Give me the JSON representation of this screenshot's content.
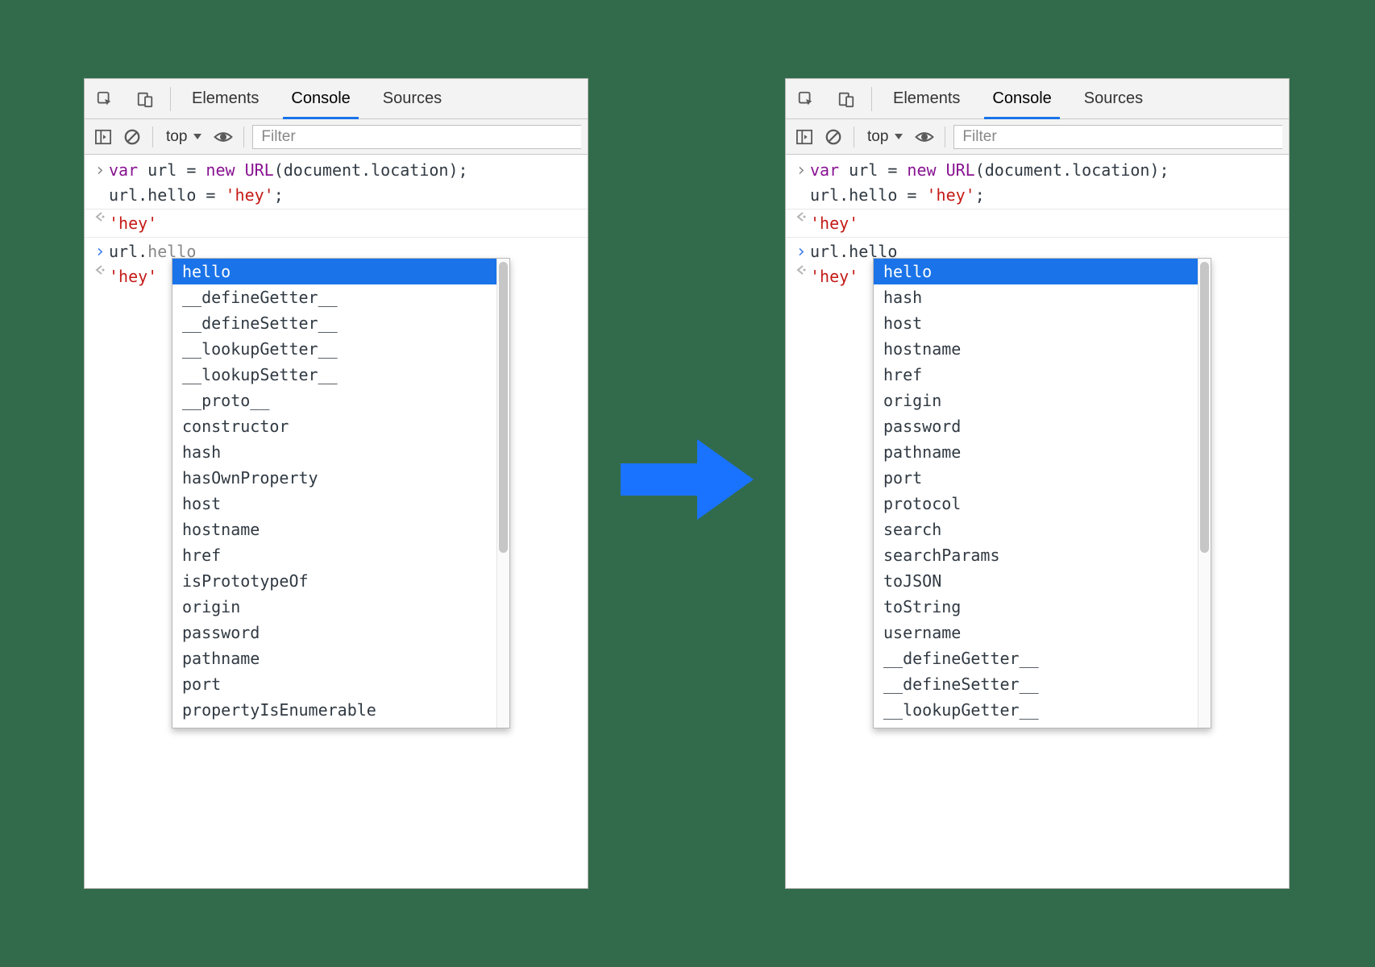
{
  "tabs": {
    "elements": "Elements",
    "console": "Console",
    "sources": "Sources"
  },
  "toolbar": {
    "context": "top",
    "filter_placeholder": "Filter"
  },
  "console": {
    "line1a": "var",
    "line1b": " url = ",
    "line1c": "new",
    "line1d": " URL",
    "line1e": "(document.location);",
    "line2": "url.hello = ",
    "line2s": "'hey'",
    "line2t": ";",
    "out1": "'hey'",
    "in2a": "url.",
    "in2b": "hello",
    "out2": "'hey'"
  },
  "autocomplete_left": [
    "hello",
    "__defineGetter__",
    "__defineSetter__",
    "__lookupGetter__",
    "__lookupSetter__",
    "__proto__",
    "constructor",
    "hash",
    "hasOwnProperty",
    "host",
    "hostname",
    "href",
    "isPrototypeOf",
    "origin",
    "password",
    "pathname",
    "port",
    "propertyIsEnumerable"
  ],
  "autocomplete_right": [
    "hello",
    "hash",
    "host",
    "hostname",
    "href",
    "origin",
    "password",
    "pathname",
    "port",
    "protocol",
    "search",
    "searchParams",
    "toJSON",
    "toString",
    "username",
    "__defineGetter__",
    "__defineSetter__",
    "__lookupGetter__"
  ]
}
